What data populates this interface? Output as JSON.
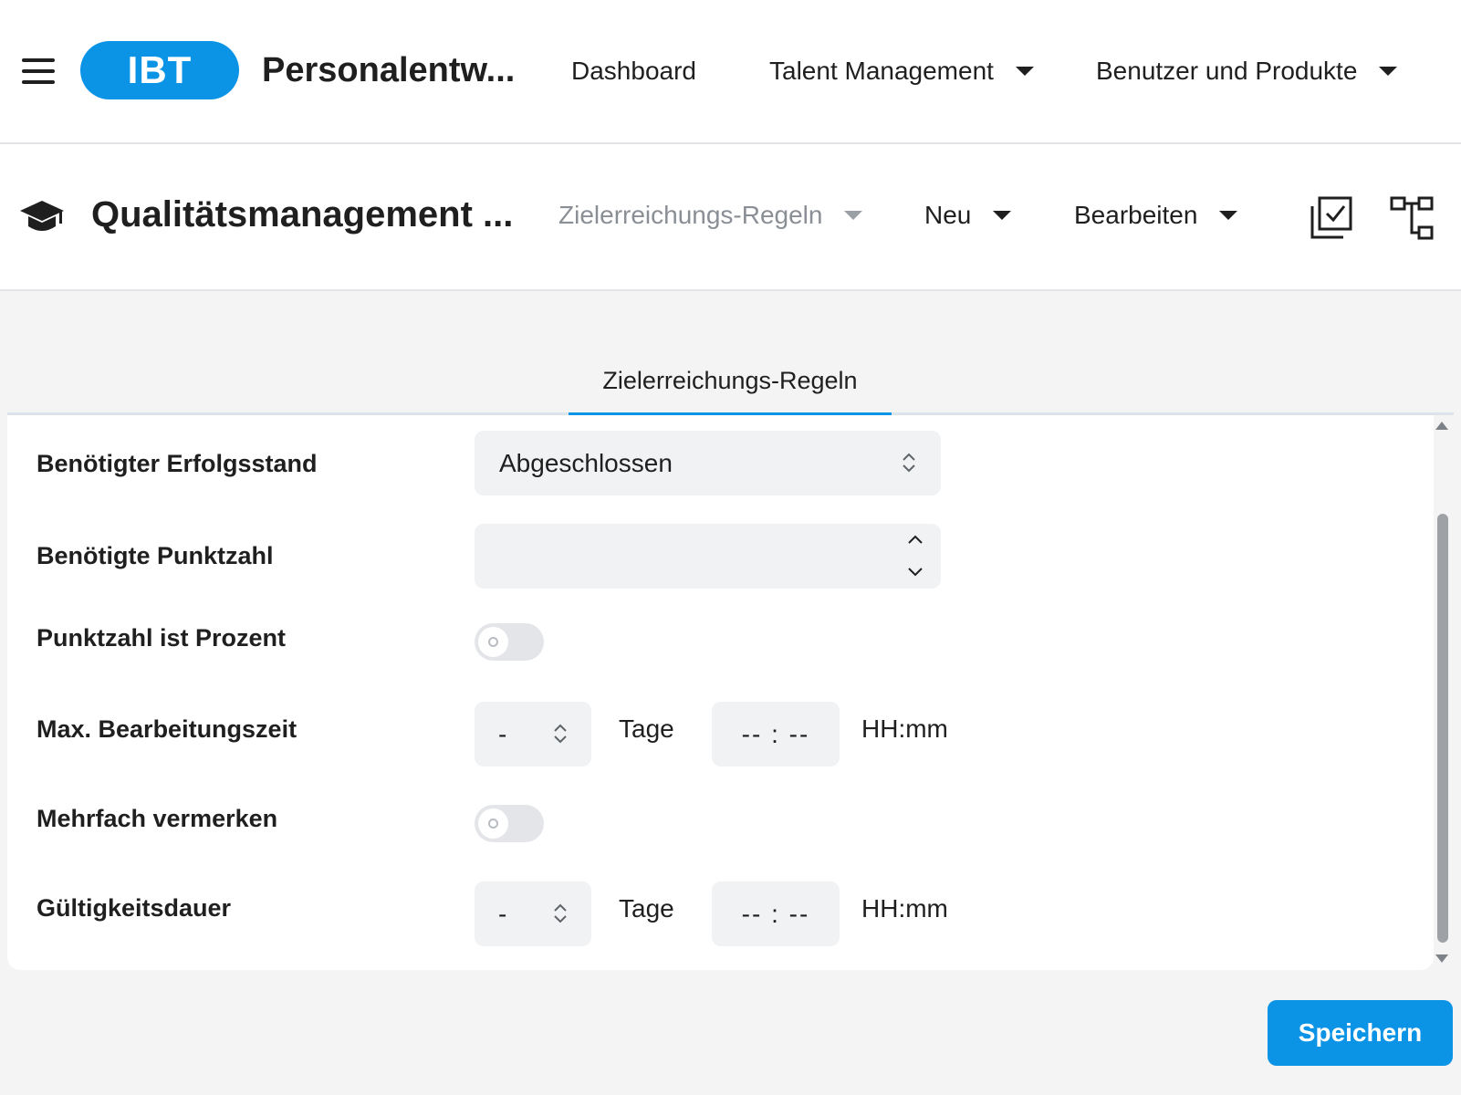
{
  "header": {
    "logo_text": "IBT",
    "app_title": "Personalentw...",
    "nav": {
      "dashboard": "Dashboard",
      "talent_management": "Talent Management",
      "users_products": "Benutzer und Produkte"
    }
  },
  "subheader": {
    "module_title": "Qualitätsmanagement ...",
    "current_view": "Zielerreichungs-Regeln",
    "new_label": "Neu",
    "edit_label": "Bearbeiten"
  },
  "tabs": [
    {
      "label": "Zielerreichungs-Regeln",
      "active": true
    }
  ],
  "form": {
    "required_status": {
      "label": "Benötigter Erfolgsstand",
      "value": "Abgeschlossen"
    },
    "required_score": {
      "label": "Benötigte Punktzahl",
      "value": ""
    },
    "score_is_percent": {
      "label": "Punktzahl ist Prozent",
      "checked": false
    },
    "max_processing_time": {
      "label": "Max. Bearbeitungszeit",
      "days": "-",
      "days_unit": "Tage",
      "time": "-- : --",
      "time_unit": "HH:mm"
    },
    "multiple_mark": {
      "label": "Mehrfach vermerken",
      "checked": false
    },
    "validity_duration": {
      "label": "Gültigkeitsdauer",
      "days": "-",
      "days_unit": "Tage",
      "time": "-- : --",
      "time_unit": "HH:mm"
    }
  },
  "footer": {
    "save_label": "Speichern"
  },
  "colors": {
    "accent": "#0b93e6",
    "field_bg": "#f1f2f4",
    "page_bg": "#f4f4f5"
  },
  "icons": [
    "hamburger-icon",
    "graduation-cap-icon",
    "checklist-icon",
    "hierarchy-icon",
    "sort-arrows-icon",
    "chevron-up-icon",
    "chevron-down-icon"
  ]
}
